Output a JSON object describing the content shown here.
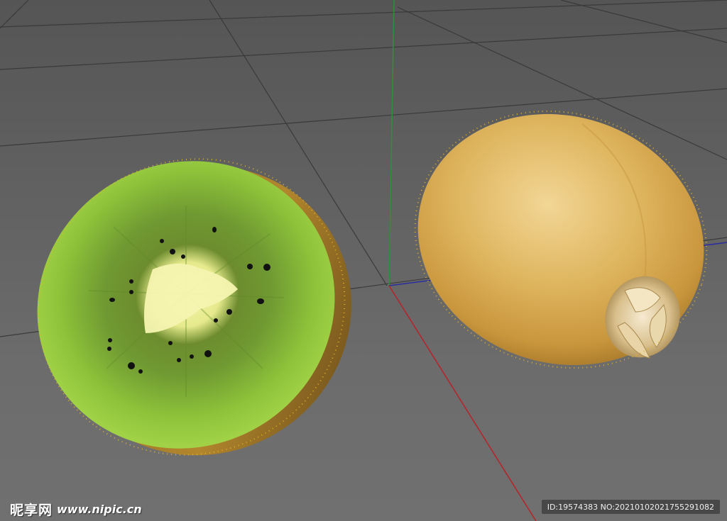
{
  "viewport": {
    "background_color": "#6a6a6a",
    "grid_color": "#3a3a3a",
    "axes": {
      "x_axis_color": "#b3262c",
      "y_axis_color": "#2f8f3a",
      "z_axis_color": "#2b2f9c"
    }
  },
  "objects": [
    {
      "name": "kiwi-half-sliced",
      "flesh_color": "#8fc43a",
      "core_color": "#f3f2a8",
      "seed_color": "#111111",
      "skin_color": "#b2862d"
    },
    {
      "name": "kiwi-whole",
      "skin_color": "#d6a94f",
      "fuzz_color": "#e3b22a"
    }
  ],
  "watermark": {
    "site_name": "昵享网",
    "url": "www.nipic.cn",
    "id_text": "ID:19574383 NO:20210102021755291082"
  }
}
